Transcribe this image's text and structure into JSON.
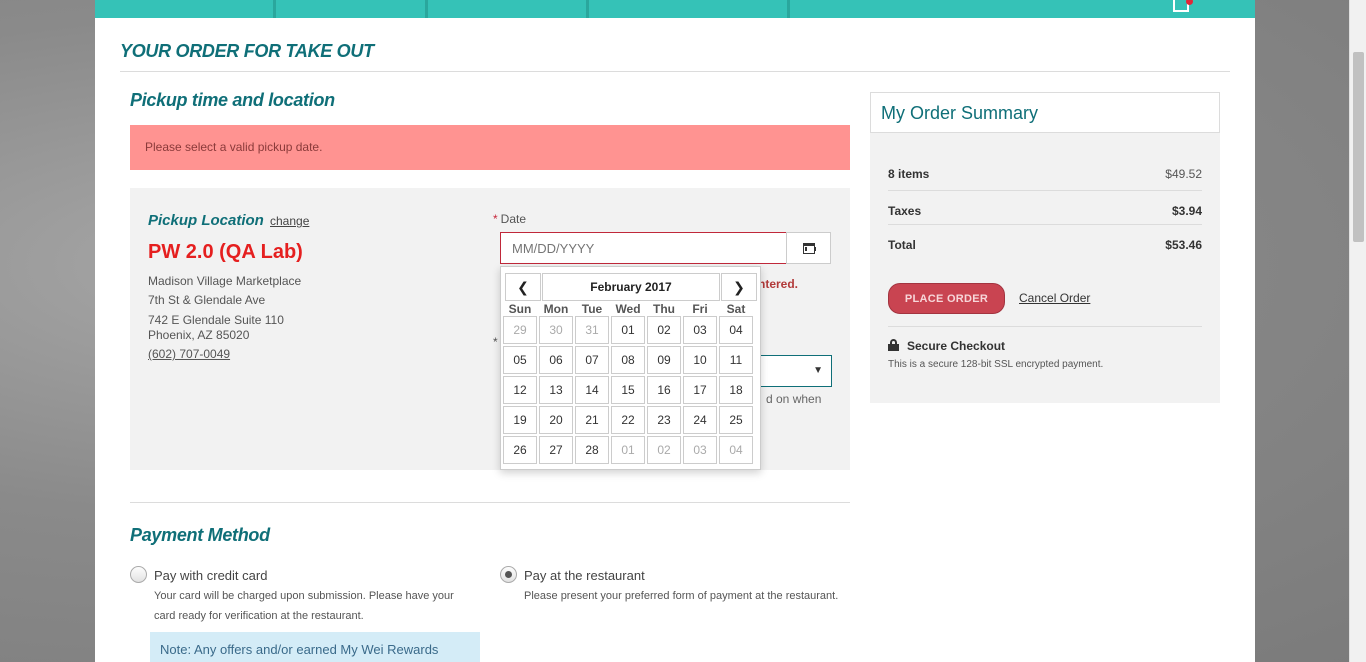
{
  "page_title": "YOUR ORDER FOR TAKE OUT",
  "pickup": {
    "heading": "Pickup time and location",
    "alert": "Please select a valid pickup date.",
    "location_label": "Pickup Location",
    "change_link": "change",
    "store_name": "PW 2.0 (QA Lab)",
    "address_lines": [
      "Madison Village Marketplace",
      "7th St & Glendale Ave",
      "742 E Glendale Suite 110",
      "Phoenix, AZ 85020"
    ],
    "phone": "(602) 707-0049",
    "date_label": "Date",
    "date_placeholder": "MM/DD/YYYY",
    "date_error_fragment": "ntered.",
    "time_required_mark": "*",
    "time_help_fragment": "d on when"
  },
  "datepicker": {
    "month_title": "February 2017",
    "prev_icon": "chevron-left-icon",
    "next_icon": "chevron-right-icon",
    "weekdays": [
      "Sun",
      "Mon",
      "Tue",
      "Wed",
      "Thu",
      "Fri",
      "Sat"
    ],
    "weeks": [
      [
        {
          "d": "29",
          "m": true
        },
        {
          "d": "30",
          "m": true
        },
        {
          "d": "31",
          "m": true
        },
        {
          "d": "01",
          "m": false
        },
        {
          "d": "02",
          "m": false
        },
        {
          "d": "03",
          "m": false
        },
        {
          "d": "04",
          "m": false
        }
      ],
      [
        {
          "d": "05",
          "m": false
        },
        {
          "d": "06",
          "m": false
        },
        {
          "d": "07",
          "m": false
        },
        {
          "d": "08",
          "m": false
        },
        {
          "d": "09",
          "m": false
        },
        {
          "d": "10",
          "m": false
        },
        {
          "d": "11",
          "m": false
        }
      ],
      [
        {
          "d": "12",
          "m": false
        },
        {
          "d": "13",
          "m": false
        },
        {
          "d": "14",
          "m": false
        },
        {
          "d": "15",
          "m": false
        },
        {
          "d": "16",
          "m": false
        },
        {
          "d": "17",
          "m": false
        },
        {
          "d": "18",
          "m": false
        }
      ],
      [
        {
          "d": "19",
          "m": false
        },
        {
          "d": "20",
          "m": false
        },
        {
          "d": "21",
          "m": false
        },
        {
          "d": "22",
          "m": false
        },
        {
          "d": "23",
          "m": false
        },
        {
          "d": "24",
          "m": false
        },
        {
          "d": "25",
          "m": false
        }
      ],
      [
        {
          "d": "26",
          "m": false
        },
        {
          "d": "27",
          "m": false
        },
        {
          "d": "28",
          "m": false
        },
        {
          "d": "01",
          "m": true
        },
        {
          "d": "02",
          "m": true
        },
        {
          "d": "03",
          "m": true
        },
        {
          "d": "04",
          "m": true
        }
      ]
    ]
  },
  "payment": {
    "heading": "Payment Method",
    "options": [
      {
        "label": "Pay with credit card",
        "selected": false,
        "desc_lines": [
          "Your card will be charged upon submission. Please have your",
          "card ready for verification at the restaurant."
        ]
      },
      {
        "label": "Pay at the restaurant",
        "selected": true,
        "desc_lines": [
          "Please present your preferred form of payment at the restaurant."
        ]
      }
    ],
    "note": "Note: Any offers and/or earned My Wei Rewards"
  },
  "summary": {
    "heading": "My Order Summary",
    "rows": [
      {
        "label": "8 items",
        "value": "$49.52"
      },
      {
        "label": "Taxes",
        "value": "$3.94"
      },
      {
        "label": "Total",
        "value": "$53.46"
      }
    ],
    "place_order": "PLACE ORDER",
    "cancel_order": "Cancel Order",
    "secure_title": "Secure Checkout",
    "secure_desc": "This is a secure 128-bit SSL encrypted payment."
  },
  "colors": {
    "brand_teal": "#35c2b7",
    "heading_teal": "#0f6f78",
    "alert_bg": "#ff9391",
    "error_red": "#c0283a",
    "place_order_btn": "#c94451"
  }
}
